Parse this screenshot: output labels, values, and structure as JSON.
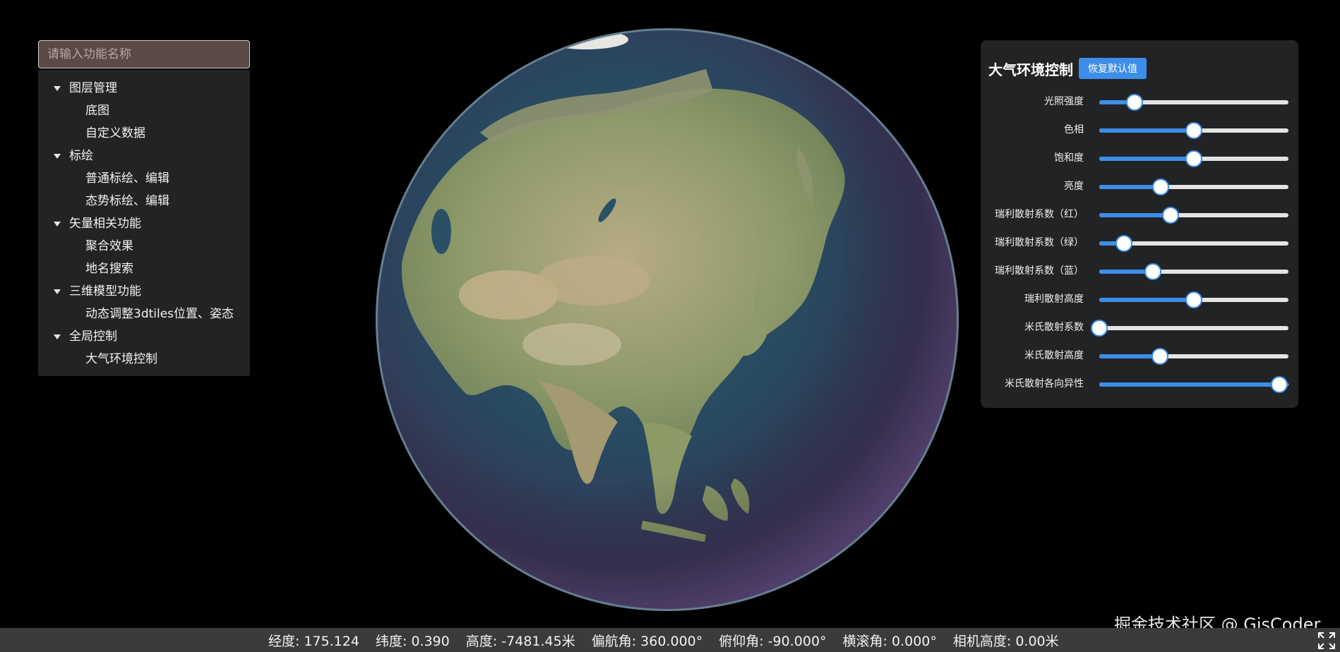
{
  "search": {
    "placeholder": "请输入功能名称"
  },
  "menu": [
    {
      "label": "图层管理",
      "children": [
        "底图",
        "自定义数据"
      ]
    },
    {
      "label": "标绘",
      "children": [
        "普通标绘、编辑",
        "态势标绘、编辑"
      ]
    },
    {
      "label": "矢量相关功能",
      "children": [
        "聚合效果",
        "地名搜索"
      ]
    },
    {
      "label": "三维模型功能",
      "children": [
        "动态调整3dtiles位置、姿态"
      ]
    },
    {
      "label": "全局控制",
      "children": [
        "大气环境控制"
      ]
    }
  ],
  "atmosphere": {
    "title": "大气环境控制",
    "reset_label": "恢复默认值",
    "sliders": [
      {
        "label": "光照强度",
        "value": 0.185
      },
      {
        "label": "色相",
        "value": 0.5
      },
      {
        "label": "饱和度",
        "value": 0.5
      },
      {
        "label": "亮度",
        "value": 0.325
      },
      {
        "label": "瑞利散射系数（红）",
        "value": 0.375
      },
      {
        "label": "瑞利散射系数（绿）",
        "value": 0.13
      },
      {
        "label": "瑞利散射系数（蓝）",
        "value": 0.285
      },
      {
        "label": "瑞利散射高度",
        "value": 0.5
      },
      {
        "label": "米氏散射系数",
        "value": 0.0
      },
      {
        "label": "米氏散射高度",
        "value": 0.32
      },
      {
        "label": "米氏散射各向异性",
        "value": 0.95
      }
    ]
  },
  "watermark": "掘金技术社区 @ GisCoder",
  "status": {
    "longitude": "经度: 175.124",
    "latitude": "纬度: 0.390",
    "height": "高度: -7481.45米",
    "heading": "偏航角: 360.000°",
    "pitch": "俯仰角: -90.000°",
    "roll": "横滚角: 0.000°",
    "camera_height": "相机高度: 0.00米"
  },
  "colors": {
    "accent": "#3d8ee8",
    "panel": "#222325",
    "statusbar": "#3a3b3d"
  },
  "icons": {
    "fullscreen": "fullscreen-expand-icon",
    "caret": "caret-down-icon"
  }
}
